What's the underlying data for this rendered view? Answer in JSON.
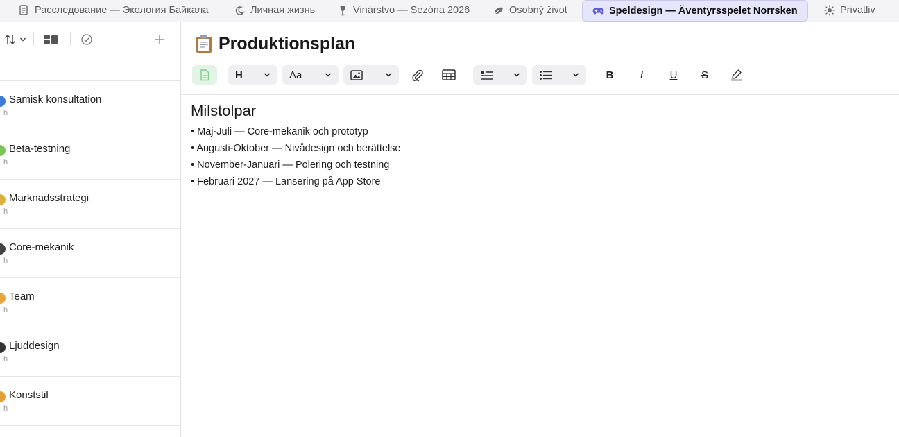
{
  "tabs": [
    {
      "label": "Расследование — Экология Байкала",
      "icon": "document-icon",
      "active": false
    },
    {
      "label": "Личная жизнь",
      "icon": "moon-icon",
      "active": false
    },
    {
      "label": "Vinárstvo — Sezóna 2026",
      "icon": "wine-glass-icon",
      "active": false
    },
    {
      "label": "Osobný život",
      "icon": "leaf-icon",
      "active": false
    },
    {
      "label": "Speldesign — Äventyrsspelet Norrsken",
      "icon": "gamepad-icon",
      "active": true
    },
    {
      "label": "Privatliv",
      "icon": "sun-icon",
      "active": false
    }
  ],
  "sidebar": {
    "items": [
      {
        "title": "Samisk konsultation",
        "sub": "h",
        "emoji_color": "#3d7bd6"
      },
      {
        "title": "Beta-testning",
        "sub": "h",
        "emoji_color": "#7cc45a"
      },
      {
        "title": "Marknadsstrategi",
        "sub": "h",
        "emoji_color": "#d8b23a"
      },
      {
        "title": "Core-mekanik",
        "sub": "h",
        "emoji_color": "#444444"
      },
      {
        "title": "Team",
        "sub": "h",
        "emoji_color": "#e5a640"
      },
      {
        "title": "Ljuddesign",
        "sub": "h",
        "emoji_color": "#333333"
      },
      {
        "title": "Konststil",
        "sub": "h",
        "emoji_color": "#e3a03a"
      }
    ]
  },
  "editor": {
    "title": "Produktionsplan",
    "toolbar": {
      "heading_label": "H",
      "font_label": "Aa",
      "bold_label": "B",
      "italic_label": "I",
      "underline_label": "U",
      "strike_label": "S"
    },
    "heading": "Milstolpar",
    "bullets": [
      "Maj-Juli — Core-mekanik och prototyp",
      "Augusti-Oktober — Nivådesign och berättelse",
      "November-Januari — Polering och testning",
      "Februari 2027 — Lansering på App Store"
    ]
  },
  "colors": {
    "active_tab_bg": "#e6e6fb",
    "active_tab_icon": "#5b5bd6",
    "doc_button_green": "#7fc98a"
  }
}
